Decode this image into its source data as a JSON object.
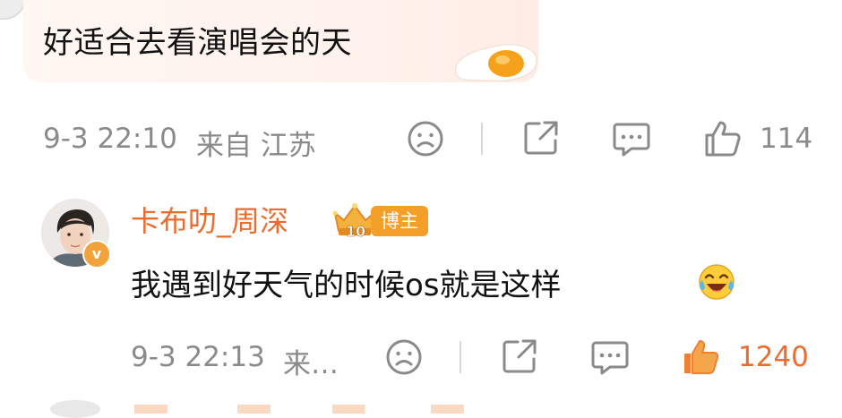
{
  "comment": {
    "text": "好适合去看演唱会的天",
    "timestamp": "9-3 22:10",
    "location": "来自 江苏",
    "like_count": "114"
  },
  "reply": {
    "author": "卡布叻_周深",
    "level": "10",
    "role_badge": "博主",
    "text": "我遇到好天气的时候os就是这样",
    "timestamp": "9-3 22:13",
    "location": "来…",
    "like_count": "1240",
    "verified_mark": "v",
    "liked": true
  },
  "colors": {
    "accent": "#ec6b2d",
    "badge": "#f4a028",
    "meta_text": "#8a8a8a"
  },
  "icons": [
    "frown-icon",
    "share-icon",
    "comment-icon",
    "thumbs-up-icon",
    "egg-sticker-icon",
    "laughing-emoji-icon",
    "crown-badge-icon"
  ]
}
